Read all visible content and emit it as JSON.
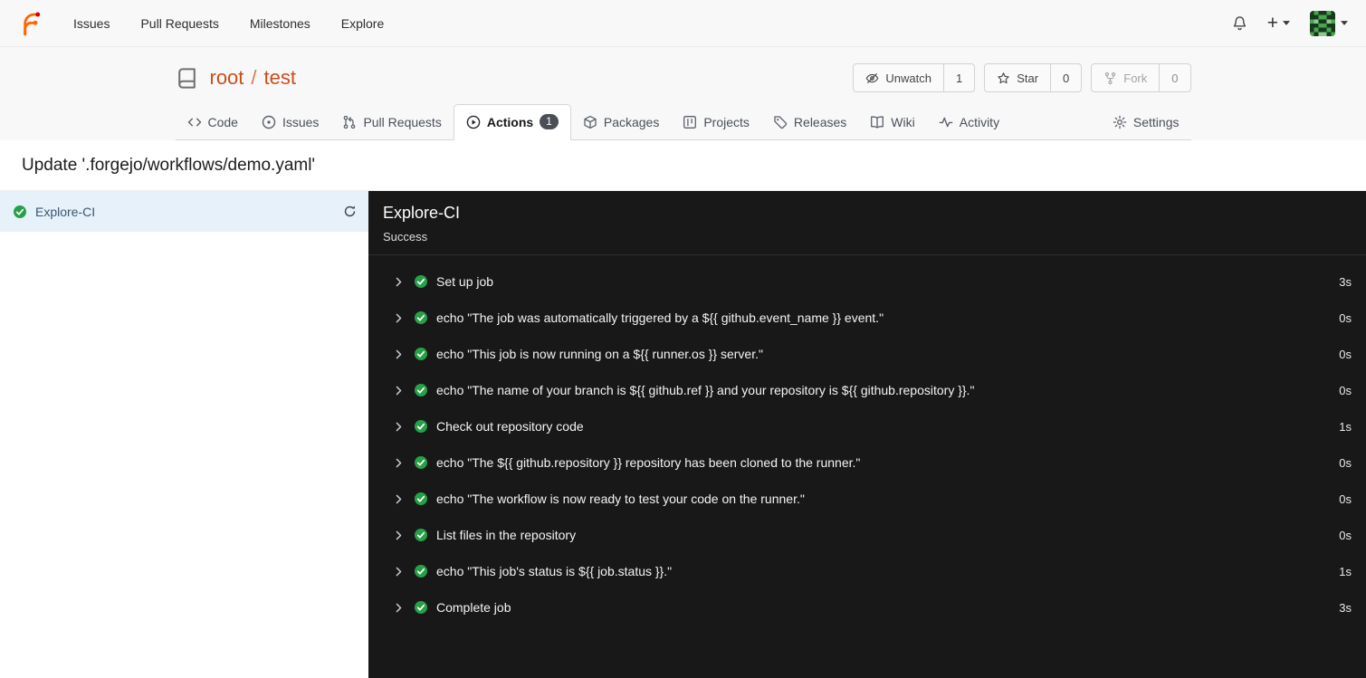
{
  "navbar": {
    "items": [
      {
        "label": "Issues"
      },
      {
        "label": "Pull Requests"
      },
      {
        "label": "Milestones"
      },
      {
        "label": "Explore"
      }
    ]
  },
  "repo": {
    "owner": "root",
    "separator": "/",
    "name": "test",
    "actions": [
      {
        "label": "Unwatch",
        "count": "1"
      },
      {
        "label": "Star",
        "count": "0"
      },
      {
        "label": "Fork",
        "count": "0"
      }
    ]
  },
  "tabs": {
    "items": [
      {
        "label": "Code"
      },
      {
        "label": "Issues"
      },
      {
        "label": "Pull Requests"
      },
      {
        "label": "Actions",
        "badge": "1"
      },
      {
        "label": "Packages"
      },
      {
        "label": "Projects"
      },
      {
        "label": "Releases"
      },
      {
        "label": "Wiki"
      },
      {
        "label": "Activity"
      }
    ],
    "settings": {
      "label": "Settings"
    }
  },
  "run": {
    "title": "Update '.forgejo/workflows/demo.yaml'",
    "sidebar": {
      "job_name": "Explore-CI"
    },
    "panel": {
      "title": "Explore-CI",
      "status": "Success"
    },
    "steps": [
      {
        "name": "Set up job",
        "duration": "3s"
      },
      {
        "name": "echo \"The job was automatically triggered by a ${{ github.event_name }} event.\"",
        "duration": "0s"
      },
      {
        "name": "echo \"This job is now running on a ${{ runner.os }} server.\"",
        "duration": "0s"
      },
      {
        "name": "echo \"The name of your branch is ${{ github.ref }} and your repository is ${{ github.repository }}.\"",
        "duration": "0s"
      },
      {
        "name": "Check out repository code",
        "duration": "1s"
      },
      {
        "name": "echo \"The ${{ github.repository }} repository has been cloned to the runner.\"",
        "duration": "0s"
      },
      {
        "name": "echo \"The workflow is now ready to test your code on the runner.\"",
        "duration": "0s"
      },
      {
        "name": "List files in the repository",
        "duration": "0s"
      },
      {
        "name": "echo \"This job's status is ${{ job.status }}.\"",
        "duration": "1s"
      },
      {
        "name": "Complete job",
        "duration": "3s"
      }
    ]
  },
  "colors": {
    "accent": "#cb4e1d",
    "success": "#26a148",
    "panel_bg": "#181818",
    "sidebar_active_bg": "#e6f1fa"
  }
}
